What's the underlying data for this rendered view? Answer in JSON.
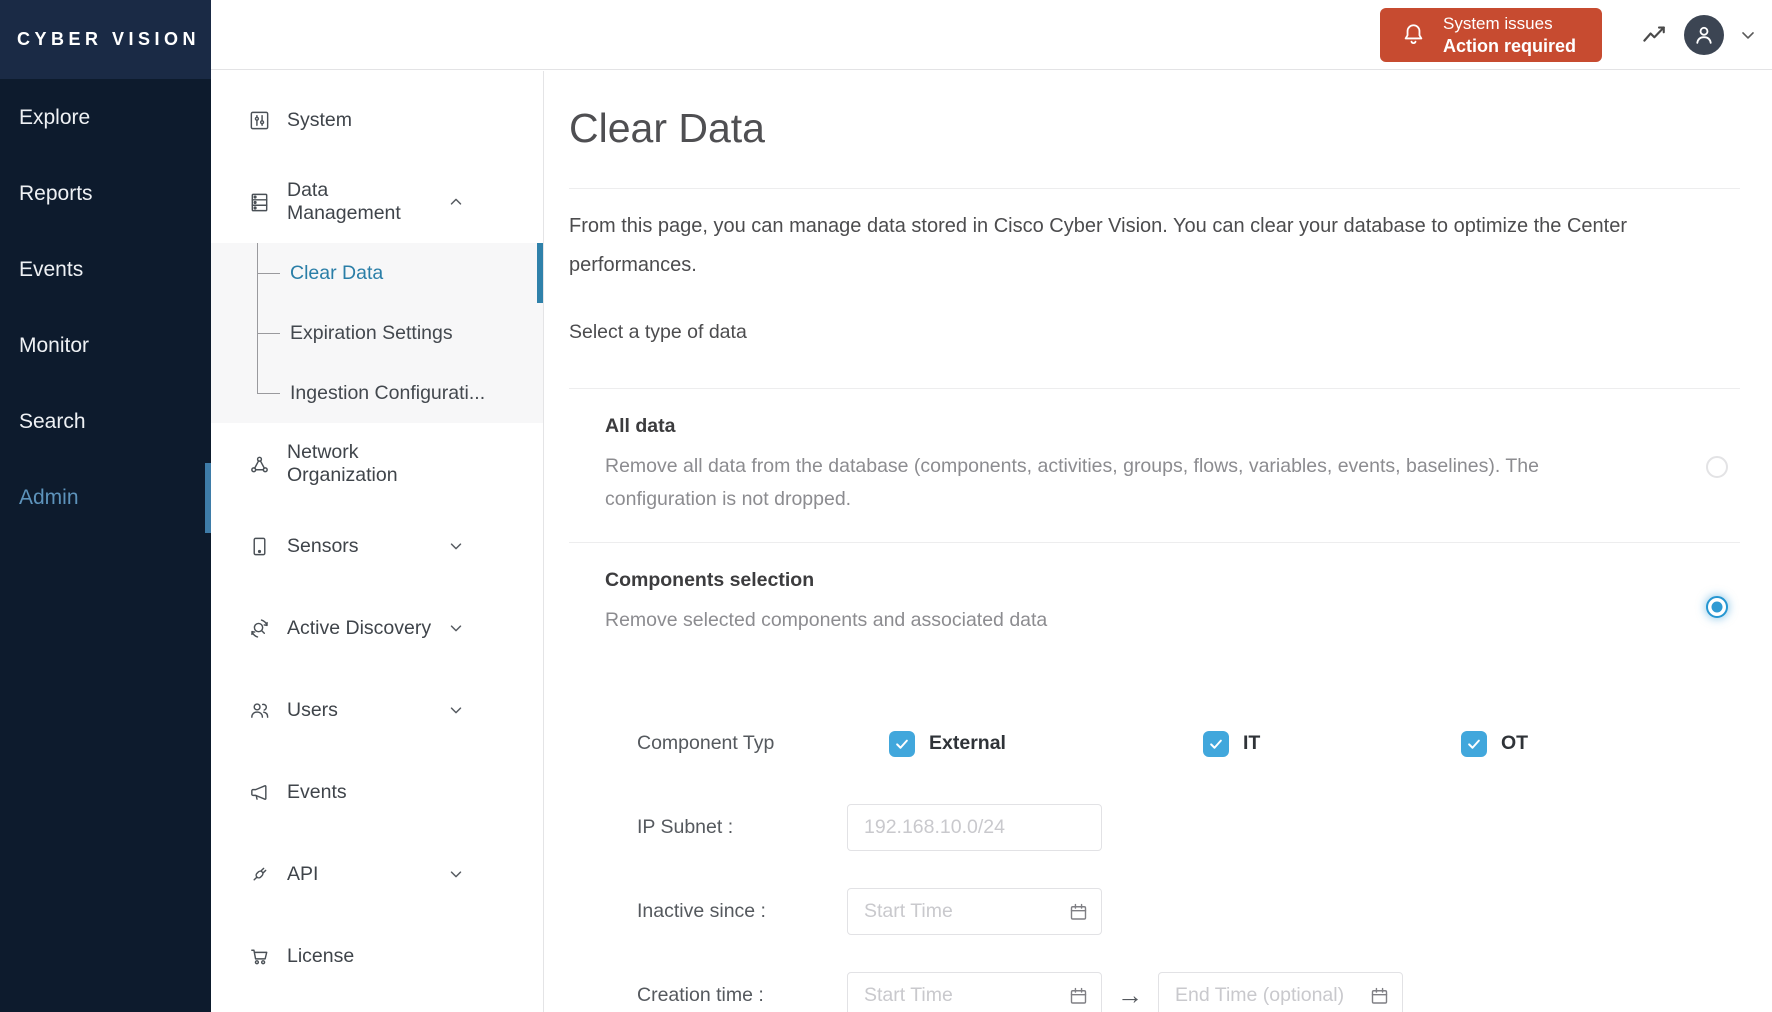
{
  "brand": {
    "logo_text": "CYBER VISION"
  },
  "primary_nav": {
    "items": [
      {
        "label": "Explore",
        "active": false
      },
      {
        "label": "Reports",
        "active": false
      },
      {
        "label": "Events",
        "active": false
      },
      {
        "label": "Monitor",
        "active": false
      },
      {
        "label": "Search",
        "active": false
      },
      {
        "label": "Admin",
        "active": true
      }
    ]
  },
  "header": {
    "alert_button": {
      "line1": "System issues",
      "line2": "Action required",
      "color": "#c74b30",
      "icon": "bell-icon"
    },
    "icons": [
      "trend-chart-icon",
      "user-avatar-icon",
      "chevron-down-icon"
    ]
  },
  "secondary_nav": {
    "items": [
      {
        "label": "System",
        "icon": "system-icon"
      },
      {
        "label": "Data Management",
        "icon": "data-management-icon",
        "expanded": true,
        "children": [
          {
            "label": "Clear Data",
            "active": true
          },
          {
            "label": "Expiration Settings",
            "active": false
          },
          {
            "label": "Ingestion Configurati...",
            "active": false
          }
        ]
      },
      {
        "label": "Network Organization",
        "icon": "network-organization-icon"
      },
      {
        "label": "Sensors",
        "icon": "sensors-icon",
        "collapsed": true
      },
      {
        "label": "Active Discovery",
        "icon": "active-discovery-icon",
        "collapsed": true
      },
      {
        "label": "Users",
        "icon": "users-icon",
        "collapsed": true
      },
      {
        "label": "Events",
        "icon": "megaphone-icon"
      },
      {
        "label": "API",
        "icon": "plug-icon",
        "collapsed": true
      },
      {
        "label": "License",
        "icon": "cart-icon"
      }
    ]
  },
  "page": {
    "title": "Clear Data",
    "intro": "From this page, you can manage data stored in Cisco Cyber Vision. You can clear your database to optimize the Center performances.",
    "select_label": "Select a type of data",
    "options": [
      {
        "title": "All data",
        "description": "Remove all data from the database (components, activities, groups, flows, variables, events, baselines). The configuration is not dropped.",
        "selected": false
      },
      {
        "title": "Components selection",
        "description": "Remove selected components and associated data",
        "selected": true
      }
    ],
    "form": {
      "component_type_label": "Component Typ",
      "component_types": [
        {
          "label": "External",
          "checked": true
        },
        {
          "label": "IT",
          "checked": true
        },
        {
          "label": "OT",
          "checked": true
        }
      ],
      "ip_subnet": {
        "label": "IP Subnet :",
        "placeholder": "192.168.10.0/24",
        "value": ""
      },
      "inactive_since": {
        "label": "Inactive since :",
        "placeholder": "Start Time",
        "value": ""
      },
      "creation_time": {
        "label": "Creation time :",
        "start_placeholder": "Start Time",
        "end_placeholder": "End Time (optional)",
        "start_value": "",
        "end_value": ""
      }
    }
  },
  "colors": {
    "sidebar_bg": "#0d1b2d",
    "logo_bg": "#1a2a45",
    "active_nav_blue": "#5d93bb",
    "accent_blue": "#2a7ea7",
    "checkbox_blue": "#41a7dc",
    "radio_blue": "#2e9ad3",
    "alert_red": "#c74b30",
    "avatar_bg": "#3c4553"
  }
}
